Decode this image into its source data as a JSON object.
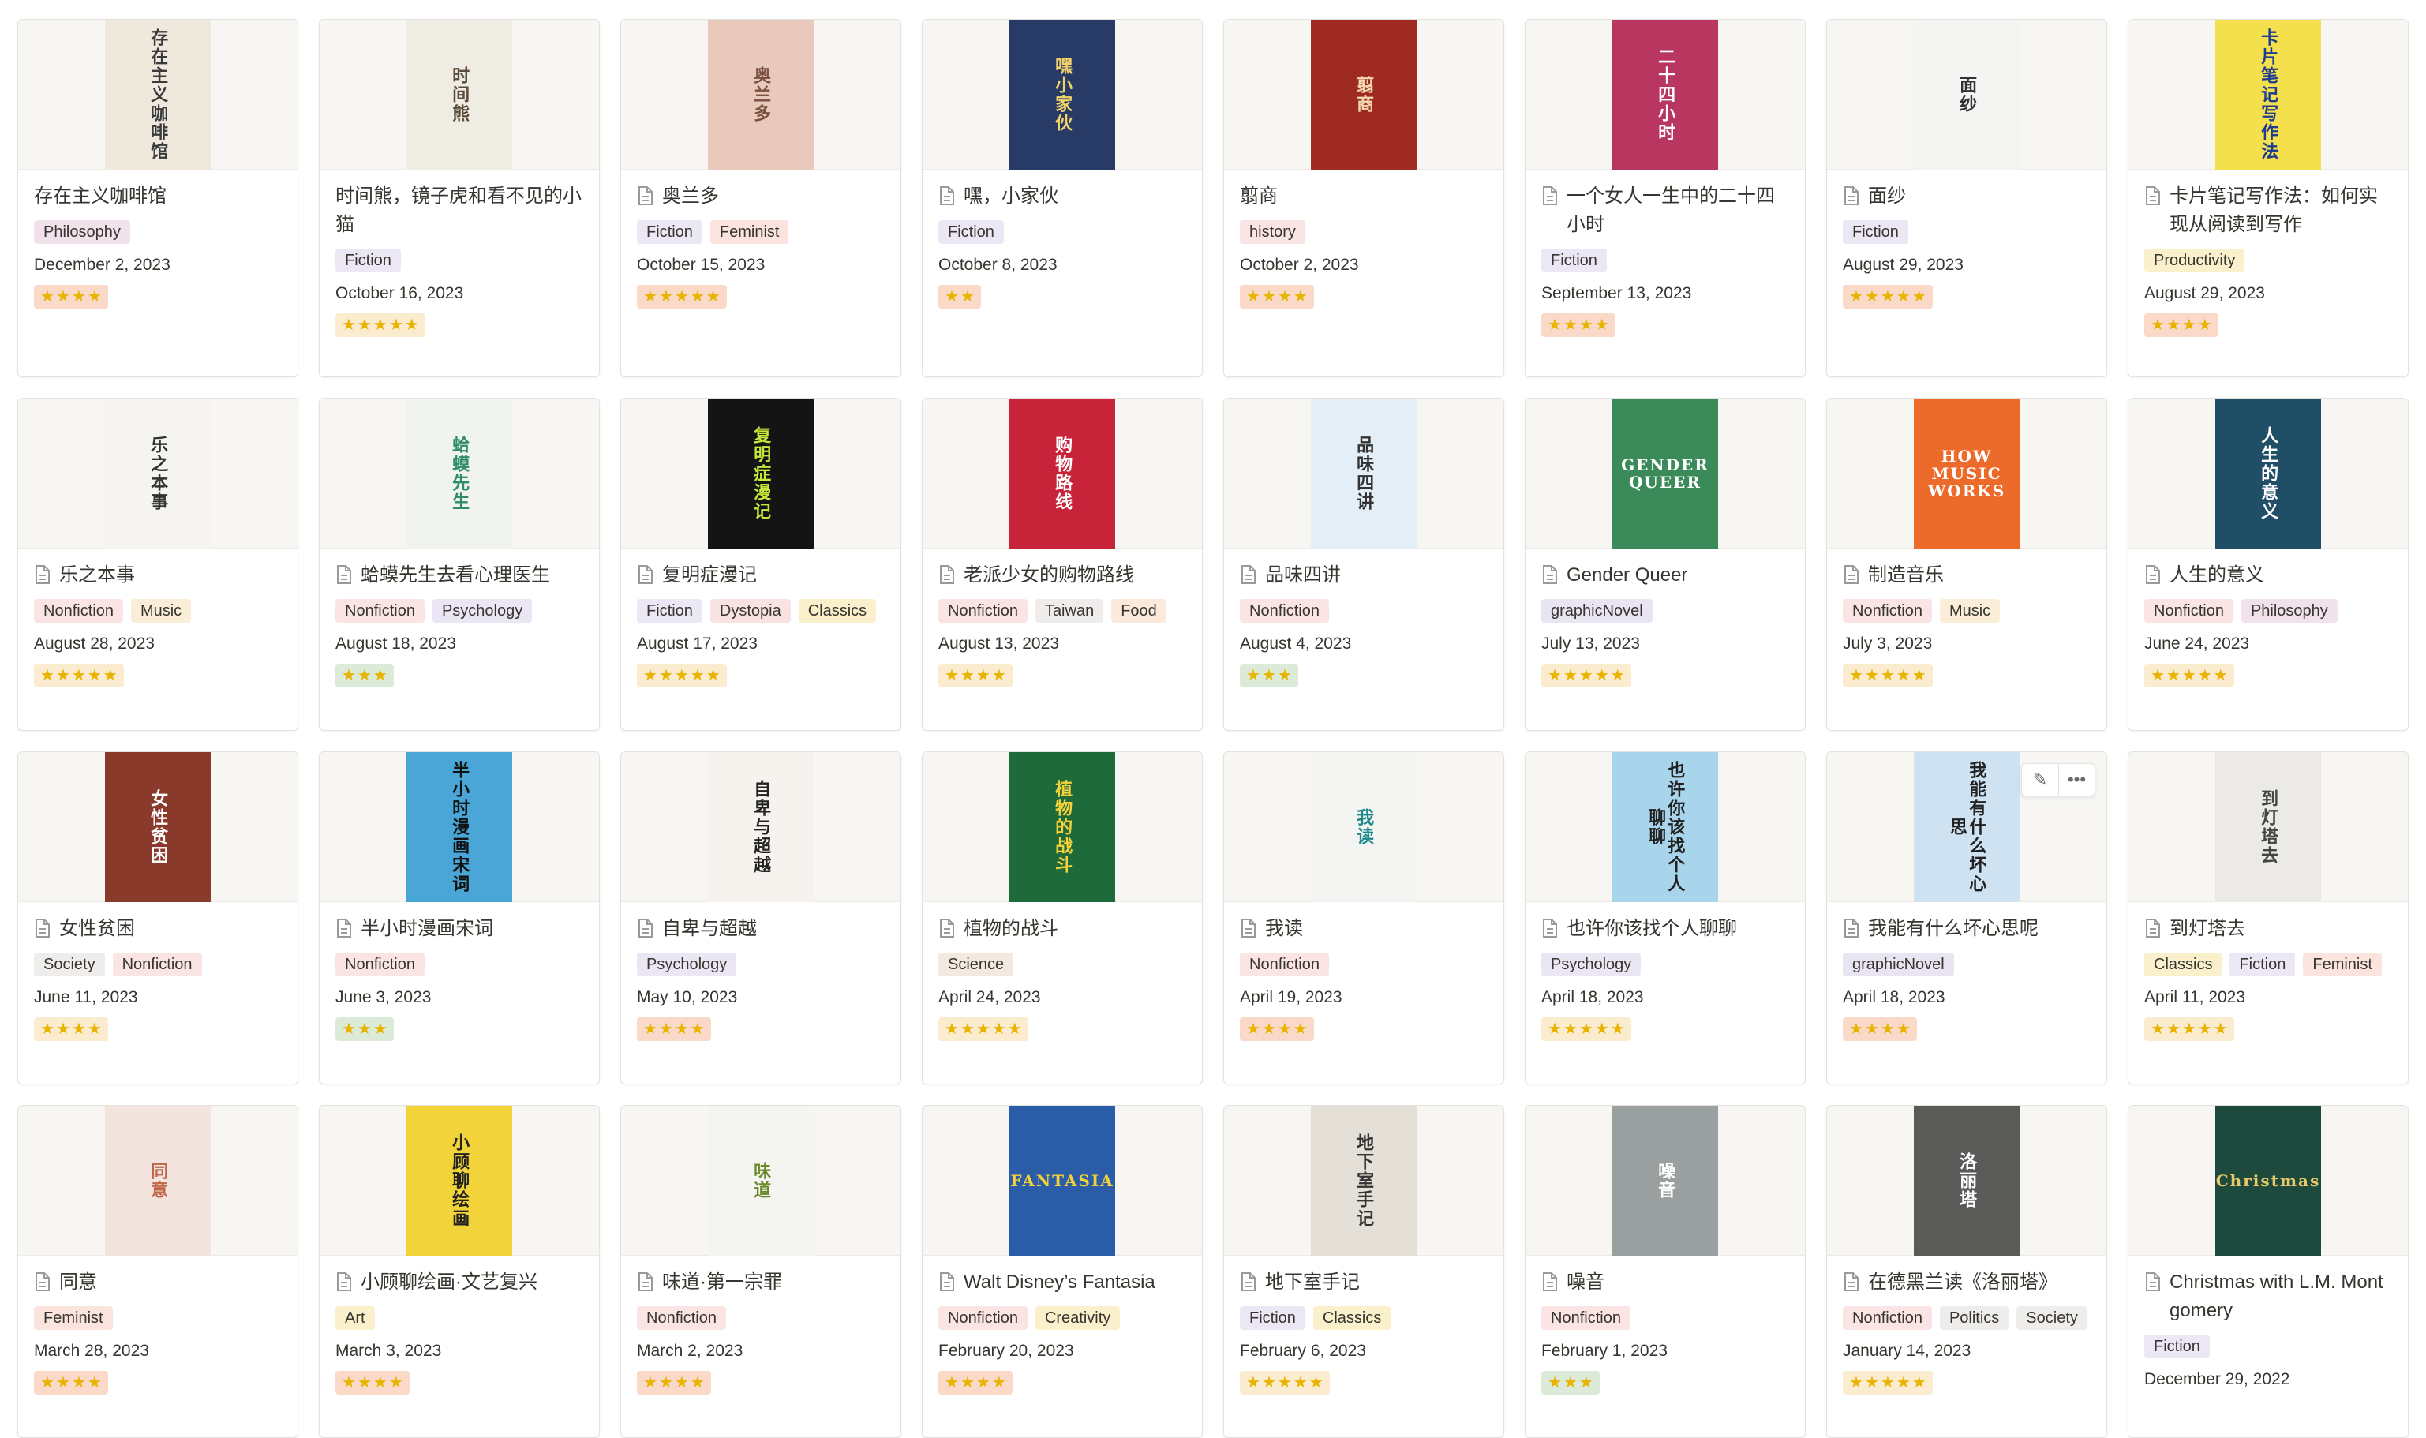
{
  "tag_colors": {
    "Philosophy": "#f1e1ea",
    "Fiction": "#ebe7f4",
    "Feminist": "#fae4dd",
    "history": "#fbe4e4",
    "Productivity": "#fbf0cc",
    "Nonfiction": "#fbe4e4",
    "Music": "#fbeed9",
    "Psychology": "#ebe6f4",
    "Dystopia": "#f9e2e2",
    "Classics": "#fbf0cc",
    "Taiwan": "#eeedeb",
    "Food": "#fbe9dc",
    "graphicNovel": "#e8e4f1",
    "Society": "#eeedeb",
    "Science": "#f3e9e1",
    "Art": "#fbf0cc",
    "Creativity": "#fbf0cc",
    "Politics": "#eeedeb"
  },
  "rating_colors": {
    "orange": "#fbd9c8",
    "yellow": "#fbeccf",
    "green": "#dcebd8"
  },
  "books": [
    {
      "title": "存在主义咖啡馆",
      "tags": [
        "Philosophy"
      ],
      "date": "December 2, 2023",
      "stars": 4,
      "rating_color": "orange",
      "icon": false,
      "cover_bg": "#efe9dd",
      "cover_fg": "#3a3a3a",
      "cover_text": "存在主义咖啡馆"
    },
    {
      "title": "时间熊，镜子虎和看不见的小猫",
      "tags": [
        "Fiction"
      ],
      "date": "October 16, 2023",
      "stars": 5,
      "rating_color": "yellow",
      "icon": false,
      "cover_bg": "#eeece3",
      "cover_fg": "#5a4a3a",
      "cover_text": "时间熊"
    },
    {
      "title": "奥兰多",
      "tags": [
        "Fiction",
        "Feminist"
      ],
      "date": "October 15, 2023",
      "stars": 5,
      "rating_color": "orange",
      "icon": true,
      "cover_bg": "#e9c9bb",
      "cover_fg": "#7a5040",
      "cover_text": "奥兰多"
    },
    {
      "title": "嘿，小家伙",
      "tags": [
        "Fiction"
      ],
      "date": "October 8, 2023",
      "stars": 2,
      "rating_color": "orange",
      "icon": true,
      "cover_bg": "#283a66",
      "cover_fg": "#f3d36b",
      "cover_text": "嘿小家伙"
    },
    {
      "title": "翦商",
      "tags": [
        "history"
      ],
      "date": "October 2, 2023",
      "stars": 4,
      "rating_color": "orange",
      "icon": false,
      "cover_bg": "#9e2a22",
      "cover_fg": "#f3d7b0",
      "cover_text": "翦商"
    },
    {
      "title": "一个女人一生中的二十四小时",
      "tags": [
        "Fiction"
      ],
      "date": "September 13, 2023",
      "stars": 4,
      "rating_color": "orange",
      "icon": true,
      "cover_bg": "#b8365f",
      "cover_fg": "#ffffff",
      "cover_text": "二十四小时"
    },
    {
      "title": "面纱",
      "tags": [
        "Fiction"
      ],
      "date": "August 29, 2023",
      "stars": 5,
      "rating_color": "orange",
      "icon": true,
      "cover_bg": "#f4f4f2",
      "cover_fg": "#333333",
      "cover_text": "面纱"
    },
    {
      "title": "卡片笔记写作法：如何实现从阅读到写作",
      "tags": [
        "Productivity"
      ],
      "date": "August 29, 2023",
      "stars": 4,
      "rating_color": "orange",
      "icon": true,
      "cover_bg": "#f4e04d",
      "cover_fg": "#1f3c8f",
      "cover_text": "卡片笔记写作法"
    },
    {
      "title": "乐之本事",
      "tags": [
        "Nonfiction",
        "Music"
      ],
      "date": "August 28, 2023",
      "stars": 5,
      "rating_color": "yellow",
      "icon": true,
      "cover_bg": "#f5f4f0",
      "cover_fg": "#333333",
      "cover_text": "乐之本事"
    },
    {
      "title": "蛤蟆先生去看心理医生",
      "tags": [
        "Nonfiction",
        "Psychology"
      ],
      "date": "August 18, 2023",
      "stars": 3,
      "rating_color": "green",
      "icon": true,
      "cover_bg": "#f0f3ee",
      "cover_fg": "#2e8b6b",
      "cover_text": "蛤蟆先生"
    },
    {
      "title": "复明症漫记",
      "tags": [
        "Fiction",
        "Dystopia",
        "Classics"
      ],
      "date": "August 17, 2023",
      "stars": 5,
      "rating_color": "yellow",
      "icon": true,
      "cover_bg": "#141414",
      "cover_fg": "#c5e83a",
      "cover_text": "复明症漫记"
    },
    {
      "title": "老派少女的购物路线",
      "tags": [
        "Nonfiction",
        "Taiwan",
        "Food"
      ],
      "date": "August 13, 2023",
      "stars": 4,
      "rating_color": "yellow",
      "icon": true,
      "cover_bg": "#c7243a",
      "cover_fg": "#ffffff",
      "cover_text": "购物路线"
    },
    {
      "title": "品味四讲",
      "tags": [
        "Nonfiction"
      ],
      "date": "August 4, 2023",
      "stars": 3,
      "rating_color": "green",
      "icon": true,
      "cover_bg": "#e3eef6",
      "cover_fg": "#333333",
      "cover_text": "品味四讲"
    },
    {
      "title": "Gender Queer",
      "tags": [
        "graphicNovel"
      ],
      "date": "July 13, 2023",
      "stars": 5,
      "rating_color": "yellow",
      "icon": true,
      "cover_bg": "#3a8a5a",
      "cover_fg": "#ffffff",
      "cover_text": "GENDER QUEER"
    },
    {
      "title": "制造音乐",
      "tags": [
        "Nonfiction",
        "Music"
      ],
      "date": "July 3, 2023",
      "stars": 5,
      "rating_color": "yellow",
      "icon": true,
      "cover_bg": "#ec6a2a",
      "cover_fg": "#ffffff",
      "cover_text": "HOW MUSIC WORKS"
    },
    {
      "title": "人生的意义",
      "tags": [
        "Nonfiction",
        "Philosophy"
      ],
      "date": "June 24, 2023",
      "stars": 5,
      "rating_color": "yellow",
      "icon": true,
      "cover_bg": "#1f4e66",
      "cover_fg": "#ffffff",
      "cover_text": "人生的意义"
    },
    {
      "title": "女性贫困",
      "tags": [
        "Society",
        "Nonfiction"
      ],
      "date": "June 11, 2023",
      "stars": 4,
      "rating_color": "yellow",
      "icon": true,
      "cover_bg": "#8a3a2a",
      "cover_fg": "#ffffff",
      "cover_text": "女性贫困"
    },
    {
      "title": "半小时漫画宋词",
      "tags": [
        "Nonfiction"
      ],
      "date": "June 3, 2023",
      "stars": 3,
      "rating_color": "green",
      "icon": true,
      "cover_bg": "#4aa6d6",
      "cover_fg": "#111111",
      "cover_text": "半小时漫画宋词"
    },
    {
      "title": "自卑与超越",
      "tags": [
        "Psychology"
      ],
      "date": "May 10, 2023",
      "stars": 4,
      "rating_color": "orange",
      "icon": true,
      "cover_bg": "#f6f3ee",
      "cover_fg": "#222222",
      "cover_text": "自卑与超越"
    },
    {
      "title": "植物的战斗",
      "tags": [
        "Science"
      ],
      "date": "April 24, 2023",
      "stars": 5,
      "rating_color": "yellow",
      "icon": true,
      "cover_bg": "#1f6a3a",
      "cover_fg": "#f5d23a",
      "cover_text": "植物的战斗"
    },
    {
      "title": "我读",
      "tags": [
        "Nonfiction"
      ],
      "date": "April 19, 2023",
      "stars": 4,
      "rating_color": "orange",
      "icon": true,
      "cover_bg": "#f4f4f2",
      "cover_fg": "#1a8a8a",
      "cover_text": "我读"
    },
    {
      "title": "也许你该找个人聊聊",
      "tags": [
        "Psychology"
      ],
      "date": "April 18, 2023",
      "stars": 5,
      "rating_color": "yellow",
      "icon": true,
      "cover_bg": "#a8d4ec",
      "cover_fg": "#222222",
      "cover_text": "也许你该找个人聊聊"
    },
    {
      "title": "我能有什么坏心思呢",
      "tags": [
        "graphicNovel"
      ],
      "date": "April 18, 2023",
      "stars": 4,
      "rating_color": "orange",
      "icon": true,
      "cover_bg": "#cfe2f2",
      "cover_fg": "#222222",
      "cover_text": "我能有什么坏心思"
    },
    {
      "title": "到灯塔去",
      "tags": [
        "Classics",
        "Fiction",
        "Feminist"
      ],
      "date": "April 11, 2023",
      "stars": 5,
      "rating_color": "yellow",
      "icon": true,
      "cover_bg": "#eceae6",
      "cover_fg": "#444444",
      "cover_text": "到灯塔去"
    },
    {
      "title": "同意",
      "tags": [
        "Feminist"
      ],
      "date": "March 28, 2023",
      "stars": 4,
      "rating_color": "orange",
      "icon": true,
      "cover_bg": "#f3e4de",
      "cover_fg": "#c0664a",
      "cover_text": "同意"
    },
    {
      "title": "小顾聊绘画·文艺复兴",
      "tags": [
        "Art"
      ],
      "date": "March 3, 2023",
      "stars": 4,
      "rating_color": "orange",
      "icon": true,
      "cover_bg": "#f2d43a",
      "cover_fg": "#222222",
      "cover_text": "小顾聊绘画"
    },
    {
      "title": "味道·第一宗罪",
      "tags": [
        "Nonfiction"
      ],
      "date": "March 2, 2023",
      "stars": 4,
      "rating_color": "orange",
      "icon": true,
      "cover_bg": "#f4f4f0",
      "cover_fg": "#6a8a2a",
      "cover_text": "味道"
    },
    {
      "title": "Walt Disney’s Fantasia",
      "tags": [
        "Nonfiction",
        "Creativity"
      ],
      "date": "February 20, 2023",
      "stars": 4,
      "rating_color": "orange",
      "icon": true,
      "cover_bg": "#2a5ca8",
      "cover_fg": "#f5d23a",
      "cover_text": "FANTASIA"
    },
    {
      "title": "地下室手记",
      "tags": [
        "Fiction",
        "Classics"
      ],
      "date": "February 6, 2023",
      "stars": 5,
      "rating_color": "yellow",
      "icon": true,
      "cover_bg": "#e4e0d8",
      "cover_fg": "#333333",
      "cover_text": "地下室手记"
    },
    {
      "title": "噪音",
      "tags": [
        "Nonfiction"
      ],
      "date": "February 1, 2023",
      "stars": 3,
      "rating_color": "green",
      "icon": true,
      "cover_bg": "#9aa0a0",
      "cover_fg": "#ffffff",
      "cover_text": "噪音"
    },
    {
      "title": "在德黑兰读《洛丽塔》",
      "tags": [
        "Nonfiction",
        "Politics",
        "Society"
      ],
      "date": "January 14, 2023",
      "stars": 5,
      "rating_color": "yellow",
      "icon": true,
      "cover_bg": "#5a5a58",
      "cover_fg": "#ffffff",
      "cover_text": "洛丽塔"
    },
    {
      "title": "Christmas with L.M. Montgomery",
      "tags": [
        "Fiction"
      ],
      "date": "December 29, 2022",
      "stars": 0,
      "rating_color": "yellow",
      "icon": true,
      "cover_bg": "#1e4a3e",
      "cover_fg": "#e9c86a",
      "cover_text": "Christmas"
    }
  ],
  "hover_tools": {
    "edit_glyph": "✎",
    "more_glyph": "•••"
  }
}
